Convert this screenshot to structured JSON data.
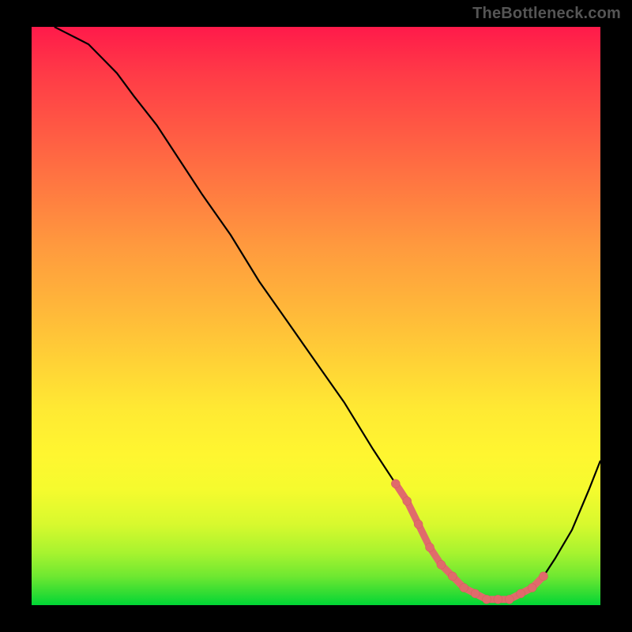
{
  "watermark": "TheBottleneck.com",
  "chart_data": {
    "type": "line",
    "title": "",
    "xlabel": "",
    "ylabel": "",
    "xlim": [
      0,
      100
    ],
    "ylim": [
      0,
      100
    ],
    "series": [
      {
        "name": "bottleneck-curve",
        "x": [
          4,
          6,
          8,
          10,
          12,
          15,
          18,
          22,
          26,
          30,
          35,
          40,
          45,
          50,
          55,
          60,
          64,
          66,
          68,
          70,
          72,
          74,
          76,
          78,
          80,
          82,
          84,
          86,
          88,
          90,
          92,
          95,
          98,
          100
        ],
        "y": [
          100,
          99,
          98,
          97,
          95,
          92,
          88,
          83,
          77,
          71,
          64,
          56,
          49,
          42,
          35,
          27,
          21,
          18,
          14,
          10,
          7,
          5,
          3,
          2,
          1,
          1,
          1,
          2,
          3,
          5,
          8,
          13,
          20,
          25
        ]
      }
    ],
    "highlight": {
      "name": "optimal-range-dots",
      "x": [
        64,
        66,
        68,
        70,
        72,
        74,
        76,
        78,
        80,
        82,
        84,
        86,
        88,
        90
      ],
      "y": [
        21,
        18,
        14,
        10,
        7,
        5,
        3,
        2,
        1,
        1,
        1,
        2,
        3,
        5
      ]
    },
    "colors": {
      "gradient_top": "#ff1a4a",
      "gradient_mid": "#ffe933",
      "gradient_bottom": "#00d635",
      "curve": "#000000",
      "dots": "#e06b6b",
      "background": "#000000"
    }
  }
}
